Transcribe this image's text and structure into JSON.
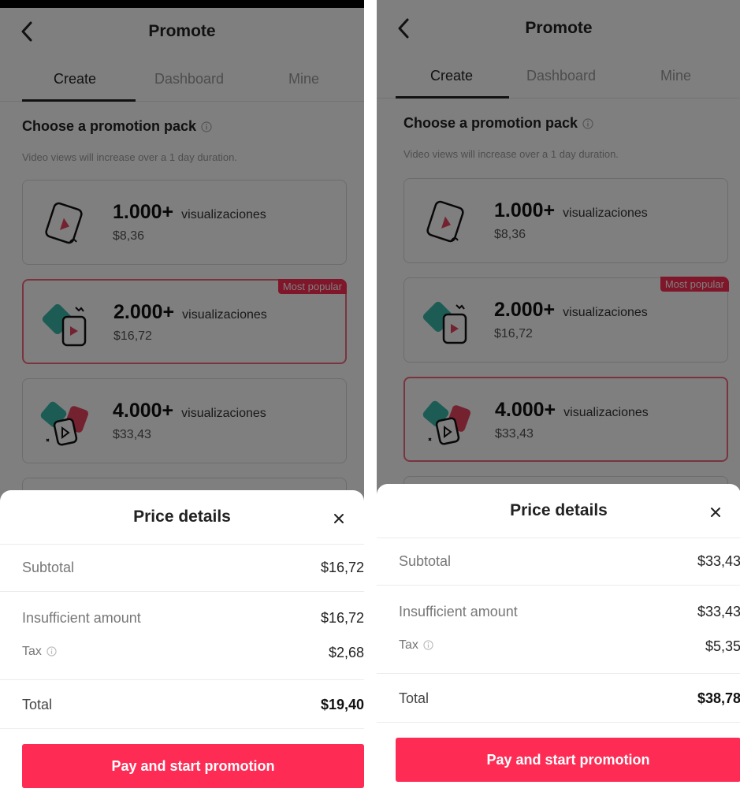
{
  "screens": [
    {
      "header": {
        "title": "Promote"
      },
      "tabs": [
        {
          "label": "Create"
        },
        {
          "label": "Dashboard"
        },
        {
          "label": "Mine"
        }
      ],
      "section": {
        "title": "Choose a promotion pack",
        "subtitle": "Video views will increase over a 1 day duration."
      },
      "packs": [
        {
          "count": "1.000+",
          "unit": "visualizaciones",
          "price": "$8,36"
        },
        {
          "count": "2.000+",
          "unit": "visualizaciones",
          "price": "$16,72",
          "badge": "Most popular"
        },
        {
          "count": "4.000+",
          "unit": "visualizaciones",
          "price": "$33,43"
        }
      ],
      "sheet": {
        "title": "Price details",
        "subtotal_label": "Subtotal",
        "subtotal_value": "$16,72",
        "insufficient_label": "Insufficient amount",
        "insufficient_value": "$16,72",
        "tax_label": "Tax",
        "tax_value": "$2,68",
        "total_label": "Total",
        "total_value": "$19,40",
        "button_label": "Pay and start promotion"
      }
    },
    {
      "header": {
        "title": "Promote"
      },
      "tabs": [
        {
          "label": "Create"
        },
        {
          "label": "Dashboard"
        },
        {
          "label": "Mine"
        }
      ],
      "section": {
        "title": "Choose a promotion pack",
        "subtitle": "Video views will increase over a 1 day duration."
      },
      "packs": [
        {
          "count": "1.000+",
          "unit": "visualizaciones",
          "price": "$8,36"
        },
        {
          "count": "2.000+",
          "unit": "visualizaciones",
          "price": "$16,72",
          "badge": "Most popular"
        },
        {
          "count": "4.000+",
          "unit": "visualizaciones",
          "price": "$33,43"
        }
      ],
      "sheet": {
        "title": "Price details",
        "subtotal_label": "Subtotal",
        "subtotal_value": "$33,43",
        "insufficient_label": "Insufficient amount",
        "insufficient_value": "$33,43",
        "tax_label": "Tax",
        "tax_value": "$5,35",
        "total_label": "Total",
        "total_value": "$38,78",
        "button_label": "Pay and start promotion"
      }
    }
  ],
  "colors": {
    "accent": "#fe2c55",
    "selected_border": "#f2697f",
    "teal": "#3bb9a8"
  }
}
